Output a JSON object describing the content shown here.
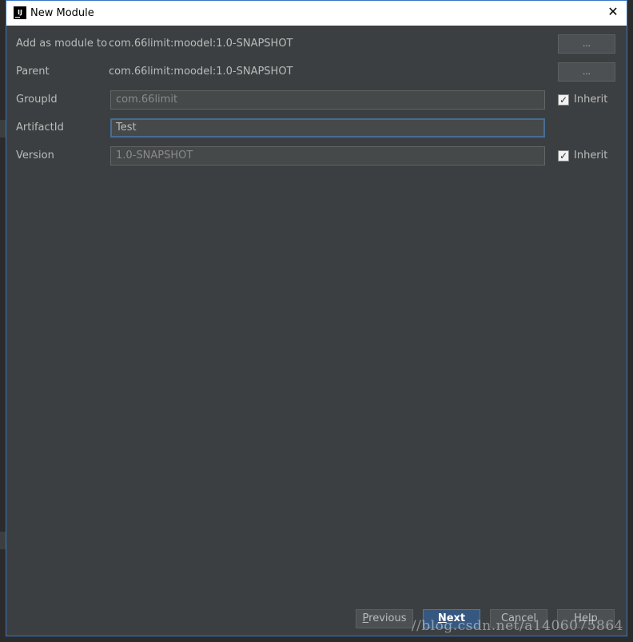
{
  "window": {
    "title": "New Module",
    "app_icon_letter": "IJ"
  },
  "form": {
    "add_as_module": {
      "label": "Add as module to",
      "value": "com.66limit:moodel:1.0-SNAPSHOT",
      "button": "..."
    },
    "parent": {
      "label": "Parent",
      "value": "com.66limit:moodel:1.0-SNAPSHOT",
      "button": "..."
    },
    "group_id": {
      "label": "GroupId",
      "value": "com.66limit",
      "inherit_label": "Inherit",
      "inherit_checked": true
    },
    "artifact_id": {
      "label": "ArtifactId",
      "value": "Test"
    },
    "version": {
      "label": "Version",
      "value": "1.0-SNAPSHOT",
      "inherit_label": "Inherit",
      "inherit_checked": true
    }
  },
  "buttons": {
    "previous_first": "P",
    "previous_rest": "revious",
    "next_first": "N",
    "next_rest": "ext",
    "cancel": "Cancel",
    "help": "Help"
  },
  "checkmark": "✓",
  "watermark": "//blog.csdn.net/a1406075864"
}
